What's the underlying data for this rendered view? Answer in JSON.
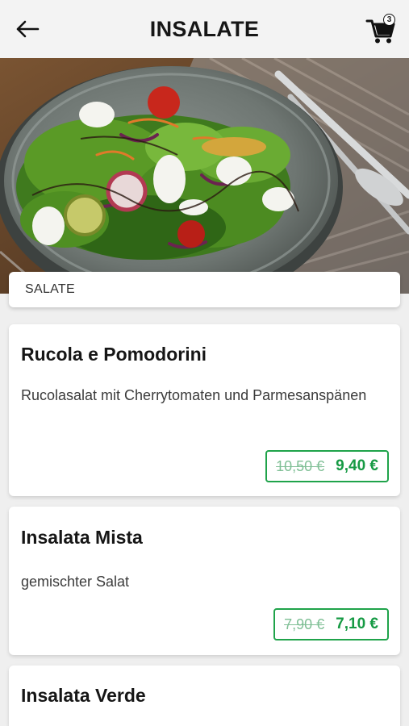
{
  "header": {
    "title": "INSALATE",
    "cart_count": "3",
    "back_icon": "arrow-left-icon",
    "cart_icon": "shopping-cart-icon"
  },
  "hero": {
    "image": "salad-bowl-photo"
  },
  "category": {
    "label": "SALATE"
  },
  "products": [
    {
      "name": "Rucola e Pomodorini",
      "description": "Rucolasalat mit Cherrytomaten und Parmesanspänen",
      "old_price": "10,50 €",
      "new_price": "9,40 €"
    },
    {
      "name": "Insalata Mista",
      "description": "gemischter Salat",
      "old_price": "7,90 €",
      "new_price": "7,10 €"
    },
    {
      "name": "Insalata Verde"
    }
  ],
  "colors": {
    "price_accent": "#169a44",
    "price_border": "#1fa34a",
    "old_price": "#7fbf95",
    "background": "#efefef"
  }
}
